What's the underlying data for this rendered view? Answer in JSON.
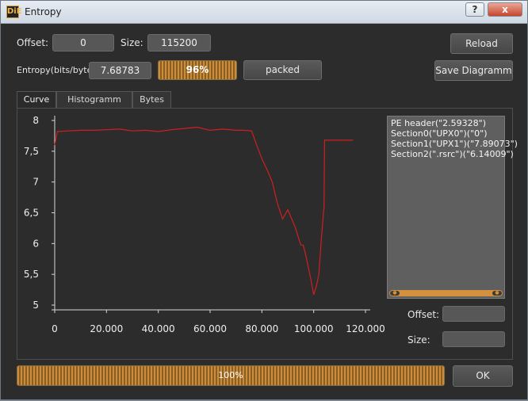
{
  "window": {
    "title": "Entropy",
    "app_icon": "DiE",
    "help_label": "?",
    "close_label": "x"
  },
  "controls": {
    "offset_label": "Offset:",
    "offset_value": "0",
    "size_label": "Size:",
    "size_value": "115200",
    "reload_label": "Reload",
    "entropy_label": "Entropy(bits/byte):",
    "entropy_value": "7.68783",
    "entropy_percent_text": "96%",
    "entropy_percent": 96,
    "status_label": "packed",
    "save_label": "Save Diagramm"
  },
  "tabs": [
    {
      "label": "Curve",
      "active": true
    },
    {
      "label": "Histogramm",
      "active": false
    },
    {
      "label": "Bytes",
      "active": false
    }
  ],
  "legend": {
    "items": [
      "PE header(\"2.59328\")",
      "Section0(\"UPX0\")(\"0\")",
      "Section1(\"UPX1\")(\"7.89073\")",
      "Section2(\".rsrc\")(\"6.14009\")"
    ]
  },
  "region": {
    "offset_label": "Offset:",
    "offset_value": "",
    "size_label": "Size:",
    "size_value": ""
  },
  "footer": {
    "progress_text": "100%",
    "progress": 100,
    "ok_label": "OK"
  },
  "colors": {
    "accent": "#d3913e",
    "curve": "#d11f1f"
  },
  "chart_data": {
    "type": "line",
    "xlim": [
      0,
      120000
    ],
    "ylim": [
      5,
      8
    ],
    "x_ticks": [
      0,
      20000,
      40000,
      60000,
      80000,
      100000,
      120000
    ],
    "x_tick_labels": [
      "0",
      "20.000",
      "40.000",
      "60.000",
      "80.000",
      "100.000",
      "120.000"
    ],
    "y_ticks": [
      5,
      5.5,
      6,
      6.5,
      7,
      7.5,
      8
    ],
    "y_tick_labels": [
      "5",
      "5,5",
      "6",
      "6,5",
      "7",
      "7,5",
      "8"
    ],
    "grid": false,
    "series": [
      {
        "x": [
          0,
          1000,
          5000,
          10000,
          15000,
          20000,
          25000,
          30000,
          35000,
          40000,
          45000,
          50000,
          55000,
          60000,
          65000,
          70000,
          73000,
          76000,
          78000,
          80000,
          82000,
          84000,
          86000,
          88000,
          90000,
          91000,
          93000,
          95000,
          96000,
          97000,
          99000,
          100000,
          101000,
          102000,
          103000,
          104000,
          104200,
          110000,
          115200
        ],
        "y": [
          7.6,
          7.82,
          7.83,
          7.84,
          7.84,
          7.85,
          7.86,
          7.83,
          7.84,
          7.82,
          7.85,
          7.87,
          7.89,
          7.84,
          7.86,
          7.84,
          7.84,
          7.83,
          7.6,
          7.38,
          7.2,
          7.0,
          6.65,
          6.4,
          6.55,
          6.45,
          6.25,
          5.98,
          5.97,
          5.8,
          5.4,
          5.17,
          5.3,
          5.5,
          6.1,
          6.6,
          7.68,
          7.68,
          7.68
        ]
      }
    ]
  }
}
